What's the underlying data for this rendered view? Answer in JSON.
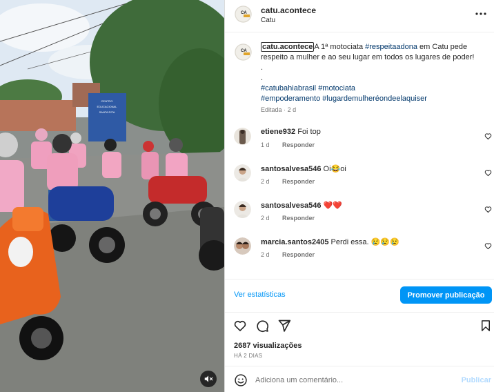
{
  "post": {
    "username": "catu.acontece",
    "location": "Catu"
  },
  "caption": {
    "username": "catu.acontece",
    "text_before": "A 1ª motociata ",
    "hashtag_inline": "#respeitaadona",
    "text_after": " em Catu pede respeito a mulher e ao seu lugar em todos os lugares de poder!",
    "dot1": ".",
    "dot2": ".",
    "hashtags_line1": [
      "#catubahiabrasil",
      "#motociata"
    ],
    "hashtags_line2": [
      "#empoderamento",
      "#lugardemulheréondeelaquiser"
    ],
    "edited": "Editada",
    "separator": "·",
    "age": "2 d"
  },
  "comments": [
    {
      "username": "etiene932",
      "text": "Foi top",
      "age": "1 d",
      "reply": "Responder"
    },
    {
      "username": "santosalvesa546",
      "text": "Oi😂oi",
      "age": "2 d",
      "reply": "Responder"
    },
    {
      "username": "santosalvesa546",
      "text": "❤️❤️",
      "age": "2 d",
      "reply": "Responder"
    },
    {
      "username": "marcia.santos2405",
      "text": "Perdi essa. 😢😢😢",
      "age": "2 d",
      "reply": "Responder"
    }
  ],
  "actions": {
    "stats_link": "Ver estatísticas",
    "promote_button": "Promover publicação"
  },
  "engagement": {
    "views": "2687 visualizações",
    "posted": "HÁ 2 DIAS"
  },
  "comment_box": {
    "placeholder": "Adiciona um comentário...",
    "publish": "Publicar"
  },
  "icons": {
    "more": "more-horizontal-icon",
    "like": "heart-icon",
    "comment": "comment-bubble-icon",
    "share": "paper-plane-icon",
    "save": "bookmark-icon",
    "emoji": "smiley-icon",
    "mute": "speaker-muted-icon"
  },
  "colors": {
    "link_blue": "#0095f6",
    "hashtag": "#00376b",
    "muted_text": "#737373",
    "publish_disabled": "#b3dbff"
  },
  "media": {
    "video_description_text": "",
    "sign_text": "CENTRO EDUCACIONAL INFANTIL SANTA RITA"
  }
}
